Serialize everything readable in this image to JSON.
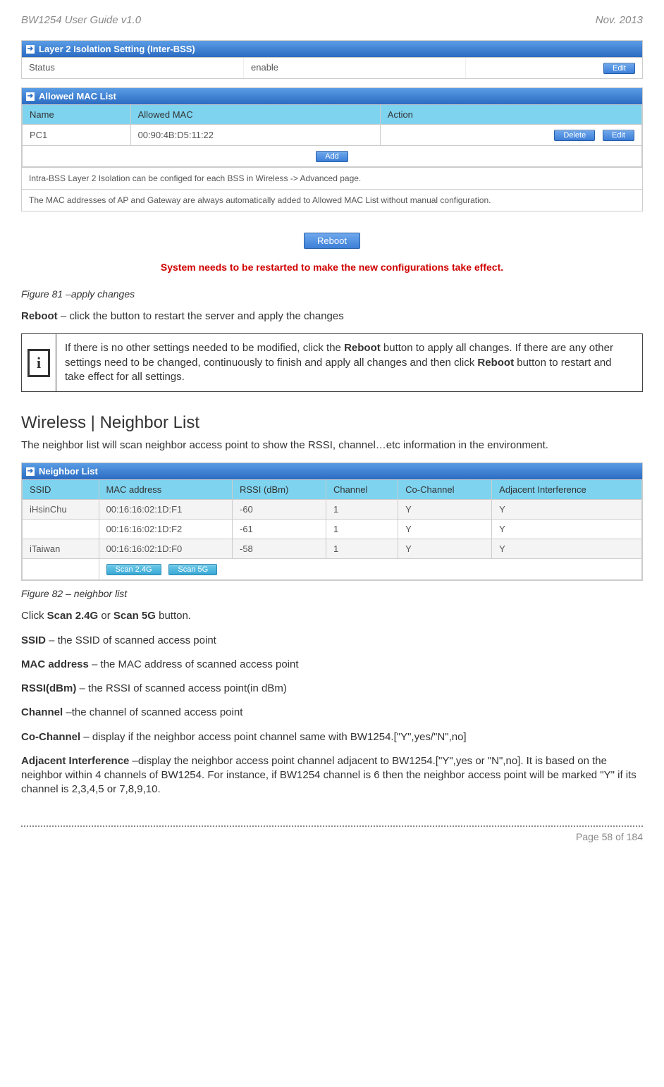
{
  "header": {
    "left": "BW1254 User Guide v1.0",
    "right": "Nov.  2013"
  },
  "panel1": {
    "title": "Layer 2 Isolation Setting (Inter-BSS)",
    "status_label": "Status",
    "status_value": "enable",
    "edit_btn": "Edit"
  },
  "panel2": {
    "title": "Allowed MAC List",
    "headers": {
      "name": "Name",
      "mac": "Allowed MAC",
      "action": "Action"
    },
    "row": {
      "name": "PC1",
      "mac": "00:90:4B:D5:11:22"
    },
    "delete_btn": "Delete",
    "edit_btn": "Edit",
    "add_btn": "Add",
    "note1": "Intra-BSS Layer 2 Isolation can be configed for each BSS in Wireless -> Advanced page.",
    "note2": "The MAC addresses of AP and Gateway are always automatically added to Allowed MAC List without manual configuration."
  },
  "reboot": {
    "btn": "Reboot",
    "msg": "System needs to be restarted to make the new configurations take effect."
  },
  "fig81": "Figure 81 –apply changes",
  "reboot_line_prefix": "Reboot",
  "reboot_line_rest": " – click the button to restart the server and apply the changes",
  "infobox": {
    "t1": "If there is no other settings needed to be modified, click the ",
    "b1": "Reboot",
    "t2": " button to apply all changes. If there are any other settings need to be changed, continuously to finish and apply all changes and then click ",
    "b2": "Reboot",
    "t3": " button to restart and take effect for all settings."
  },
  "section_title": " Wireless | Neighbor List",
  "neighbor_intro": "The neighbor list will scan neighbor access point to show the RSSI, channel…etc information in the environment.",
  "neighbor": {
    "panel_title": "Neighbor List",
    "headers": {
      "ssid": "SSID",
      "mac": "MAC address",
      "rssi": "RSSI (dBm)",
      "channel": "Channel",
      "cochannel": "Co-Channel",
      "adj": "Adjacent Interference"
    },
    "rows": [
      {
        "ssid": "iHsinChu",
        "mac": "00:16:16:02:1D:F1",
        "rssi": "-60",
        "channel": "1",
        "co": "Y",
        "adj": "Y"
      },
      {
        "ssid": "",
        "mac": "00:16:16:02:1D:F2",
        "rssi": "-61",
        "channel": "1",
        "co": "Y",
        "adj": "Y"
      },
      {
        "ssid": "iTaiwan",
        "mac": "00:16:16:02:1D:F0",
        "rssi": "-58",
        "channel": "1",
        "co": "Y",
        "adj": "Y"
      }
    ],
    "scan24": "Scan 2.4G",
    "scan5": "Scan 5G"
  },
  "fig82": "Figure 82 – neighbor list",
  "lines": {
    "click_scan_pre": "Click ",
    "scan24": "Scan 2.4G",
    "or": " or ",
    "scan5": "Scan 5G",
    "click_scan_post": " button.",
    "ssid_b": "SSID",
    "ssid_t": " – the SSID of scanned access point",
    "mac_b": "MAC address",
    "mac_t": " – the MAC address of scanned access point",
    "rssi_b": "RSSI(dBm)",
    "rssi_t": " – the RSSI of scanned access point(in dBm)",
    "channel_b": "Channel",
    "channel_t": " –the channel of scanned access point",
    "cochan_b": "Co-Channel",
    "cochan_t": " – display if the neighbor access point channel same with BW1254.[\"Y\",yes/\"N\",no]",
    "adj_b": "Adjacent Interference",
    "adj_t": " –display the neighbor access point channel adjacent to BW1254.[\"Y\",yes or \"N\",no]. It is based on the neighbor within 4 channels of BW1254. For instance, if BW1254 channel is 6 then the neighbor access point will be marked \"Y\" if its channel is 2,3,4,5 or 7,8,9,10."
  },
  "footer": "Page 58 of 184"
}
